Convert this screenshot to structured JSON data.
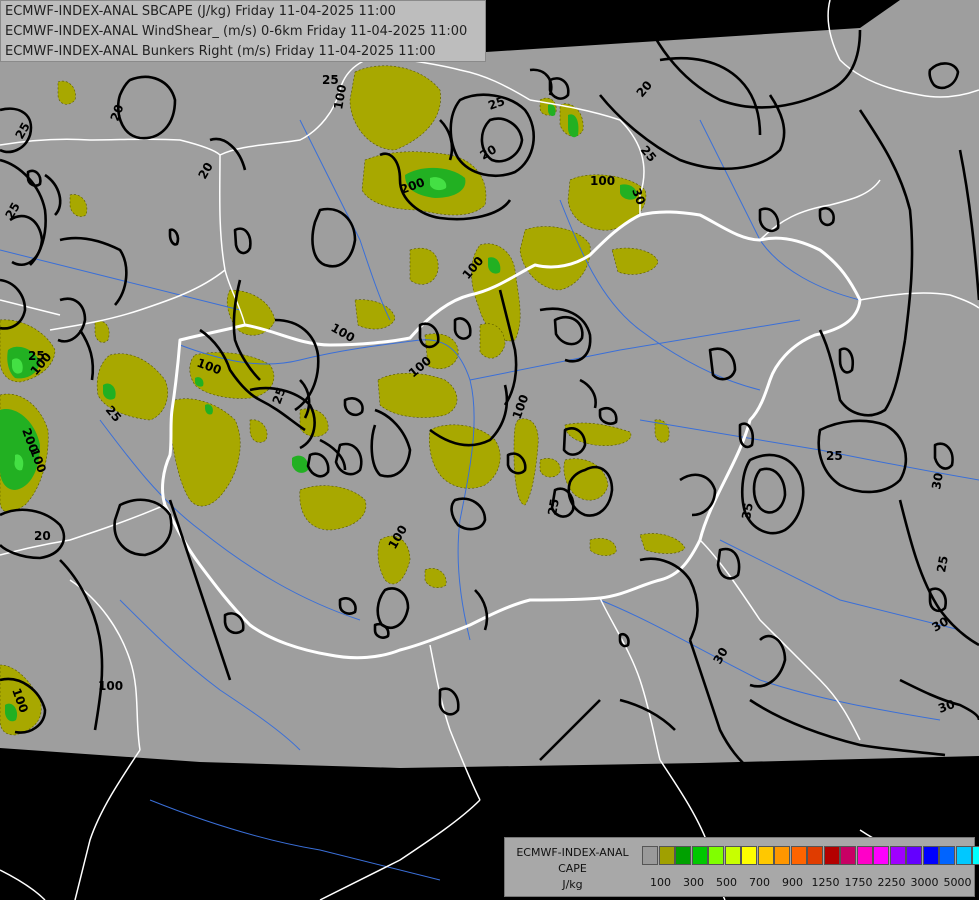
{
  "titles": [
    "ECMWF-INDEX-ANAL SBCAPE (J/kg) Friday 11-04-2025 11:00",
    "ECMWF-INDEX-ANAL WindShear_ (m/s) 0-6km Friday 11-04-2025 11:00",
    "ECMWF-INDEX-ANAL Bunkers Right (m/s) Friday 11-04-2025 11:00"
  ],
  "legend": {
    "title_lines": [
      "ECMWF-INDEX-ANAL",
      "CAPE",
      "J/kg"
    ],
    "swatches": [
      "#9a9a9a",
      "#a0a000",
      "#00a000",
      "#00c800",
      "#80ff00",
      "#c8ff00",
      "#ffff00",
      "#ffc800",
      "#ff9600",
      "#ff6400",
      "#e03c00",
      "#b40000",
      "#c80064",
      "#ff00c8",
      "#ff00ff",
      "#a000ff",
      "#6400ff",
      "#0000ff",
      "#0064ff",
      "#00c8ff",
      "#00ffff",
      "#ffffff"
    ],
    "tick_labels": [
      "100",
      "300",
      "500",
      "700",
      "900",
      "1250",
      "1750",
      "2250",
      "3000",
      "5000"
    ]
  },
  "colors": {
    "data_area": "#9e9e9e",
    "cape_100": "#a8a800",
    "cape_300": "#22b022",
    "cape_500": "#44e044",
    "borders": "#ffffff",
    "rivers": "#3a6fd8",
    "contours": "#000000"
  },
  "contour_labels": [
    "25",
    "100",
    "20",
    "25",
    "20",
    "25",
    "20",
    "25",
    "25",
    "20",
    "100",
    "200",
    "100",
    "100",
    "20",
    "30",
    "25",
    "100",
    "100",
    "100",
    "100",
    "25",
    "25",
    "100",
    "100",
    "25",
    "25",
    "35",
    "30",
    "25",
    "20",
    "100",
    "30",
    "30",
    "30",
    "100",
    "200"
  ]
}
